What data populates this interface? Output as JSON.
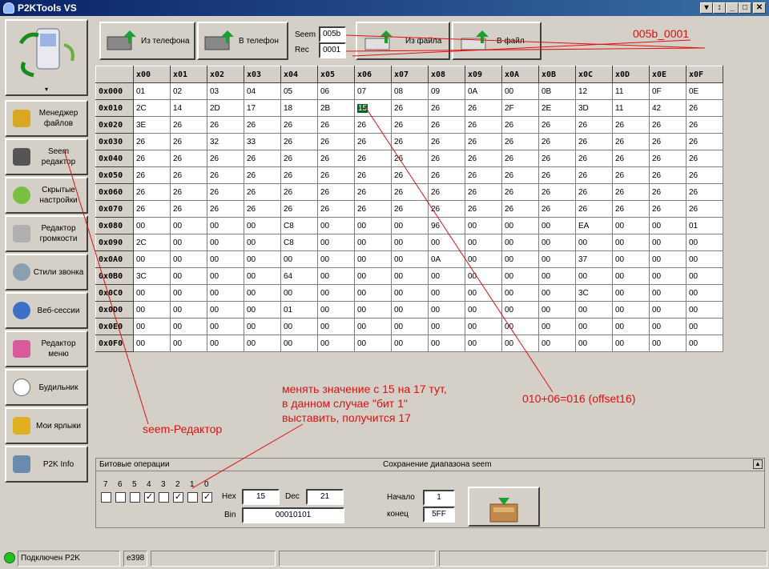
{
  "app": {
    "title": "P2KTools VS"
  },
  "sidebar": {
    "items": [
      {
        "label": "Менеджер\nфайлов"
      },
      {
        "label": "Seem\nредактор"
      },
      {
        "label": "Скрытые\nнастройки"
      },
      {
        "label": "Редактор\nгромкости"
      },
      {
        "label": "Стили звонка"
      },
      {
        "label": "Веб-сессии"
      },
      {
        "label": "Редактор\nменю"
      },
      {
        "label": "Будильник"
      },
      {
        "label": "Мои ярлыки"
      },
      {
        "label": "P2K Info"
      }
    ]
  },
  "toolbar": {
    "from_phone": "Из телефона",
    "to_phone": "В телефон",
    "seem_label": "Seem",
    "seem_value": "005b",
    "rec_label": "Rec",
    "rec_value": "0001",
    "from_file": "Из файла",
    "to_file": "В файл"
  },
  "grid": {
    "columns": [
      "x00",
      "x01",
      "x02",
      "x03",
      "x04",
      "x05",
      "x06",
      "x07",
      "x08",
      "x09",
      "x0A",
      "x0B",
      "x0C",
      "x0D",
      "x0E",
      "x0F"
    ],
    "rows": [
      {
        "label": "0x000",
        "cells": [
          "01",
          "02",
          "03",
          "04",
          "05",
          "06",
          "07",
          "08",
          "09",
          "0A",
          "00",
          "0B",
          "12",
          "11",
          "0F",
          "0E"
        ]
      },
      {
        "label": "0x010",
        "cells": [
          "2C",
          "14",
          "2D",
          "17",
          "18",
          "2B",
          "15",
          "26",
          "26",
          "26",
          "2F",
          "2E",
          "3D",
          "11",
          "42",
          "26"
        ]
      },
      {
        "label": "0x020",
        "cells": [
          "3E",
          "26",
          "26",
          "26",
          "26",
          "26",
          "26",
          "26",
          "26",
          "26",
          "26",
          "26",
          "26",
          "26",
          "26",
          "26"
        ]
      },
      {
        "label": "0x030",
        "cells": [
          "26",
          "26",
          "32",
          "33",
          "26",
          "26",
          "26",
          "26",
          "26",
          "26",
          "26",
          "26",
          "26",
          "26",
          "26",
          "26"
        ]
      },
      {
        "label": "0x040",
        "cells": [
          "26",
          "26",
          "26",
          "26",
          "26",
          "26",
          "26",
          "26",
          "26",
          "26",
          "26",
          "26",
          "26",
          "26",
          "26",
          "26"
        ]
      },
      {
        "label": "0x050",
        "cells": [
          "26",
          "26",
          "26",
          "26",
          "26",
          "26",
          "26",
          "26",
          "26",
          "26",
          "26",
          "26",
          "26",
          "26",
          "26",
          "26"
        ]
      },
      {
        "label": "0x060",
        "cells": [
          "26",
          "26",
          "26",
          "26",
          "26",
          "26",
          "26",
          "26",
          "26",
          "26",
          "26",
          "26",
          "26",
          "26",
          "26",
          "26"
        ]
      },
      {
        "label": "0x070",
        "cells": [
          "26",
          "26",
          "26",
          "26",
          "26",
          "26",
          "26",
          "26",
          "26",
          "26",
          "26",
          "26",
          "26",
          "26",
          "26",
          "26"
        ]
      },
      {
        "label": "0x080",
        "cells": [
          "00",
          "00",
          "00",
          "00",
          "C8",
          "00",
          "00",
          "00",
          "96",
          "00",
          "00",
          "00",
          "EA",
          "00",
          "00",
          "01"
        ]
      },
      {
        "label": "0x090",
        "cells": [
          "2C",
          "00",
          "00",
          "00",
          "C8",
          "00",
          "00",
          "00",
          "00",
          "00",
          "00",
          "00",
          "00",
          "00",
          "00",
          "00"
        ]
      },
      {
        "label": "0x0A0",
        "cells": [
          "00",
          "00",
          "00",
          "00",
          "00",
          "00",
          "00",
          "00",
          "0A",
          "00",
          "00",
          "00",
          "37",
          "00",
          "00",
          "00"
        ]
      },
      {
        "label": "0x0B0",
        "cells": [
          "3C",
          "00",
          "00",
          "00",
          "64",
          "00",
          "00",
          "00",
          "00",
          "00",
          "00",
          "00",
          "00",
          "00",
          "00",
          "00"
        ]
      },
      {
        "label": "0x0C0",
        "cells": [
          "00",
          "00",
          "00",
          "00",
          "00",
          "00",
          "00",
          "00",
          "00",
          "00",
          "00",
          "00",
          "3C",
          "00",
          "00",
          "00"
        ]
      },
      {
        "label": "0x0D0",
        "cells": [
          "00",
          "00",
          "00",
          "00",
          "01",
          "00",
          "00",
          "00",
          "00",
          "00",
          "00",
          "00",
          "00",
          "00",
          "00",
          "00"
        ]
      },
      {
        "label": "0x0E0",
        "cells": [
          "00",
          "00",
          "00",
          "00",
          "00",
          "00",
          "00",
          "00",
          "00",
          "00",
          "00",
          "00",
          "00",
          "00",
          "00",
          "00"
        ]
      },
      {
        "label": "0x0F0",
        "cells": [
          "00",
          "00",
          "00",
          "00",
          "00",
          "00",
          "00",
          "00",
          "00",
          "00",
          "00",
          "00",
          "00",
          "00",
          "00",
          "00"
        ]
      }
    ],
    "selected": {
      "row": 1,
      "col": 6
    }
  },
  "bitops": {
    "title": "Битовые операции",
    "bits": [
      {
        "label": "7",
        "checked": false
      },
      {
        "label": "6",
        "checked": false
      },
      {
        "label": "5",
        "checked": false
      },
      {
        "label": "4",
        "checked": true
      },
      {
        "label": "3",
        "checked": false
      },
      {
        "label": "2",
        "checked": true
      },
      {
        "label": "1",
        "checked": false
      },
      {
        "label": "0",
        "checked": true
      }
    ],
    "hex_label": "Hex",
    "hex_value": "15",
    "dec_label": "Dec",
    "dec_value": "21",
    "bin_label": "Bin",
    "bin_value": "00010101"
  },
  "save_range": {
    "title": "Сохранение диапазона seem",
    "start_label": "Начало",
    "start_value": "1",
    "end_label": "конец",
    "end_value": "5FF"
  },
  "status": {
    "connection": "Подключен P2K",
    "model": "e398",
    "led_color": "#22c022"
  },
  "annotations": {
    "seem_rec": "005b_0001",
    "instruction_1": "менять значение  с 15 на 17 тут,",
    "instruction_2": "в данном случае \"бит 1\"",
    "instruction_3": "выставить, получится 17",
    "offset": "010+06=016 (offset16)",
    "seem_editor": "seem-Редактор",
    "color": "#e01010"
  }
}
